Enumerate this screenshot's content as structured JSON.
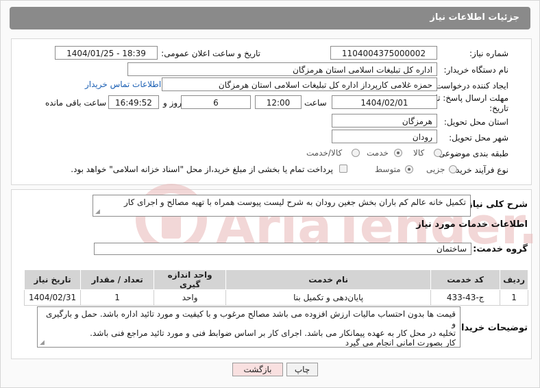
{
  "header": {
    "title": "جزئیات اطلاعات نیاز"
  },
  "form": {
    "need_number_label": "شماره نیاز:",
    "need_number": "1104004375000002",
    "announce_label": "تاریخ و ساعت اعلان عمومی:",
    "announce_value": "1404/01/25 - 18:39",
    "buyer_org_label": "نام دستگاه خریدار:",
    "buyer_org": "اداره کل تبلیغات اسلامی استان هرمزگان",
    "creator_label": "ایجاد کننده درخواست:",
    "creator": "حمزه غلامی کارپرداز اداره کل تبلیغات اسلامی استان هرمزگان",
    "contact_link": "اطلاعات تماس خریدار",
    "deadline_label_1": "مهلت ارسال پاسخ: تا",
    "deadline_label_2": "تاریخ:",
    "deadline_date": "1404/02/01",
    "time_label": "ساعت",
    "deadline_time": "12:00",
    "days_value": "6",
    "days_label": "روز و",
    "remaining_time": "16:49:52",
    "remaining_label": "ساعت باقی مانده",
    "province_label": "استان محل تحویل:",
    "province": "هرمزگان",
    "city_label": "شهر محل تحویل:",
    "city": "رودان",
    "category_label": "طبقه بندی موضوعی:",
    "category_options": [
      "کالا",
      "خدمت",
      "کالا/خدمت"
    ],
    "category_selected": "خدمت",
    "process_label": "نوع فرآیند خرید :",
    "process_options": [
      "جزیی",
      "متوسط"
    ],
    "process_selected": "متوسط",
    "payment_note": "پرداخت تمام یا بخشی از مبلغ خرید،از محل \"اسناد خزانه اسلامی\" خواهد بود."
  },
  "details": {
    "summary_label": "شرح کلی نیاز:",
    "summary": "تکمیل خانه عالم کم باران بخش جغین رودان به شرح لیست پیوست همراه با تهیه مصالح و اجرای کار",
    "services_title": "اطلاعات خدمات مورد نیاز",
    "service_group_label": "گروه خدمت:",
    "service_group": "ساختمان"
  },
  "table": {
    "headers": [
      "ردیف",
      "کد خدمت",
      "نام خدمت",
      "واحد اندازه گیری",
      "تعداد / مقدار",
      "تاریخ نیاز"
    ],
    "rows": [
      [
        "1",
        "ج-43-433",
        "پایان‌دهی و تکمیل بنا",
        "واحد",
        "1",
        "1404/02/31"
      ]
    ]
  },
  "buyer_notes": {
    "label": "توضیحات خریدار:",
    "line1": "قیمت ها بدون احتساب مالیات ارزش افزوده می باشد مصالح مرغوب و با کیفیت و مورد تائید اداره باشد. حمل و بارگیری و",
    "line2": "تخلیه در محل کار به عهده پیمانکار می باشد.    اجرای کار بر اساس ضوابط فنی و مورد تائید مراجع فنی باشد.",
    "line3": "کار بصورت امانی انجام می گیرد"
  },
  "buttons": {
    "print": "چاپ",
    "back": "بازگشت"
  },
  "watermark": {
    "text": "AriaTender.net"
  },
  "colors": {
    "header_bg": "#8a8a8a",
    "link": "#1a5fb4",
    "watermark": "#e9b7b7"
  }
}
